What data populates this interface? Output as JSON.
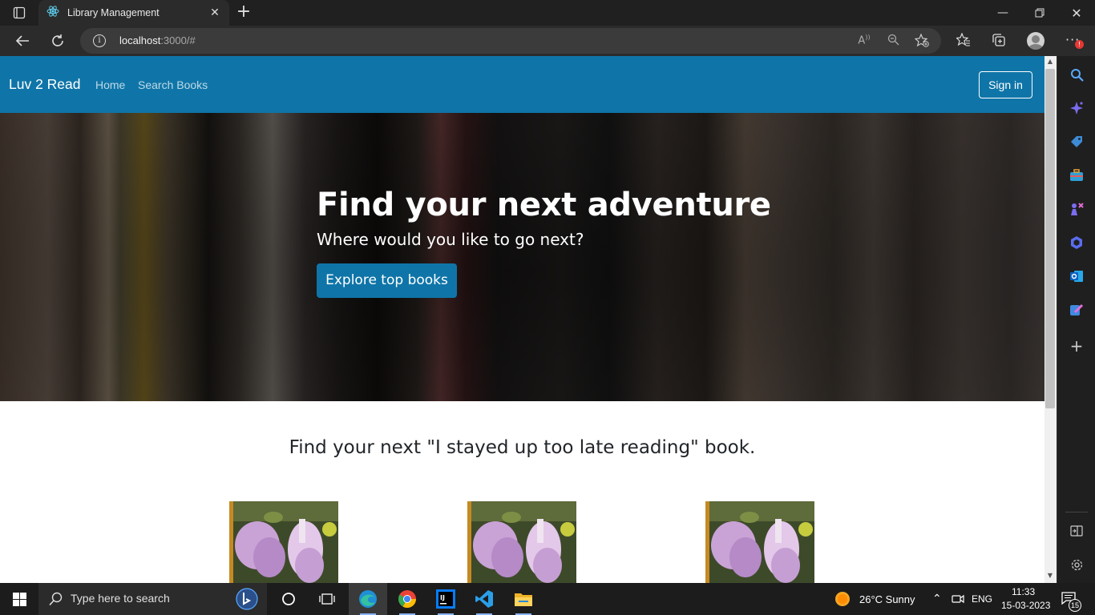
{
  "browser": {
    "tab_title": "Library Management",
    "url_host": "localhost",
    "url_path": ":3000/#"
  },
  "site": {
    "brand": "Luv 2 Read",
    "nav": {
      "home": "Home",
      "search": "Search Books"
    },
    "signin": "Sign in",
    "hero": {
      "title": "Find your next adventure",
      "subtitle": "Where would you like to go next?",
      "button": "Explore top books"
    },
    "section_title": "Find your next \"I stayed up too late reading\" book.",
    "books_shown": 3
  },
  "taskbar": {
    "search_placeholder": "Type here to search",
    "weather": "26°C  Sunny",
    "language": "ENG",
    "time": "11:33",
    "date": "15-03-2023",
    "notification_count": "15"
  },
  "colors": {
    "brand": "#0f75a8",
    "browser_dark": "#202020",
    "toolbar": "#2b2b2b"
  },
  "icons": [
    "tab-actions-icon",
    "react-favicon",
    "back-icon",
    "refresh-icon",
    "info-icon",
    "read-aloud-icon",
    "zoom-out-icon",
    "add-favorite-icon",
    "favorites-icon",
    "collections-icon",
    "profile-icon",
    "more-icon",
    "search-icon",
    "copilot-icon",
    "shopping-icon",
    "tools-icon",
    "games-icon",
    "microsoft365-icon",
    "outlook-icon",
    "designer-icon",
    "add-icon",
    "split-screen-icon",
    "settings-icon",
    "windows-start-icon",
    "cortana-icon",
    "task-view-icon",
    "edge-icon",
    "chrome-icon",
    "intellij-icon",
    "vscode-icon",
    "file-explorer-icon",
    "weather-icon",
    "chevron-up-icon",
    "meet-now-icon",
    "notification-icon"
  ]
}
